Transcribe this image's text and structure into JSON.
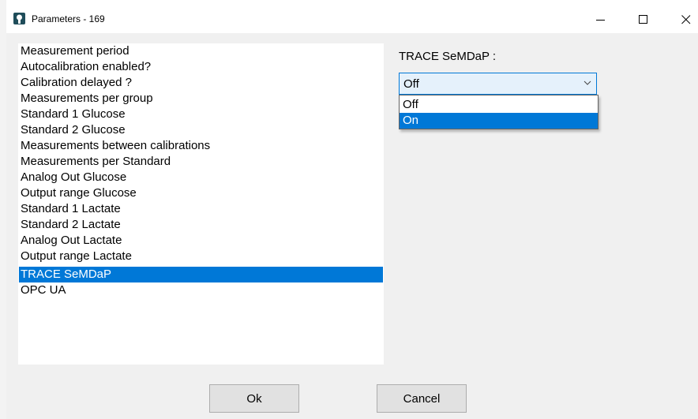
{
  "window": {
    "title": "Parameters  -  169"
  },
  "parameters": {
    "items": [
      {
        "label": "Measurement period"
      },
      {
        "label": "Autocalibration enabled?"
      },
      {
        "label": "Calibration delayed ?"
      },
      {
        "label": "Measurements per group"
      },
      {
        "label": "Standard 1 Glucose"
      },
      {
        "label": "Standard 2 Glucose"
      },
      {
        "label": "Measurements between calibrations"
      },
      {
        "label": "Measurements per Standard"
      },
      {
        "label": "Analog Out Glucose"
      },
      {
        "label": "Output range Glucose"
      },
      {
        "label": "Standard 1 Lactate"
      },
      {
        "label": "Standard 2 Lactate"
      },
      {
        "label": "Analog Out Lactate"
      },
      {
        "label": "Output range Lactate"
      },
      {
        "label": "TRACE SeMDaP"
      },
      {
        "label": "OPC UA"
      }
    ],
    "selected_index": 14
  },
  "editor": {
    "label": "TRACE SeMDaP :",
    "combo_value": "Off",
    "options": [
      "Off",
      "On"
    ],
    "highlighted_option": "On"
  },
  "buttons": {
    "ok": "Ok",
    "cancel": "Cancel"
  },
  "colors": {
    "selection": "#0078d7",
    "combo_background": "#e5f1fb",
    "dialog_background": "#f0f0f0"
  }
}
